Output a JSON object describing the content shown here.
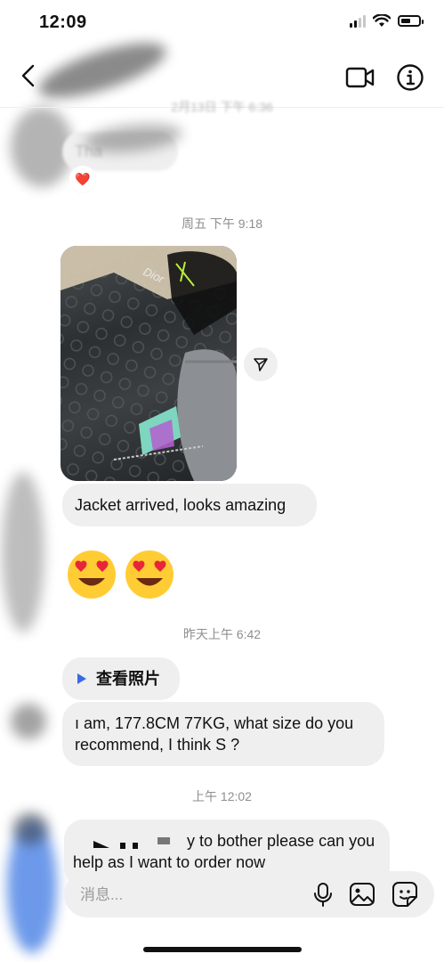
{
  "status_bar": {
    "time": "12:09"
  },
  "header": {
    "back_icon": "chevron-left-icon",
    "video_icon": "video-camera-icon",
    "info_icon": "info-icon"
  },
  "messages": {
    "faded_timestamp": "2月13日 下午 6:36",
    "faded_text": "Tha",
    "faded_reaction": "❤️",
    "ts_friday": "周五 下午 9:18",
    "jacket_text": "Jacket arrived, looks amazing",
    "emoji_pair": [
      "😍",
      "😍"
    ],
    "ts_yesterday": "昨天上午 6:42",
    "view_photo_label": "查看照片",
    "size_question_line1": "ı am, 177.8CM 77KG, what size do you",
    "size_question_line2": "recommend, I think S ?",
    "ts_noon": "上午 12:02",
    "order_line1": "y to bother please can you",
    "order_line2": "help as I want to order now"
  },
  "composer": {
    "placeholder": "消息...",
    "mic_icon": "microphone-icon",
    "gallery_icon": "image-icon",
    "sticker_icon": "sticker-icon"
  },
  "colors": {
    "bubble": "#efefef",
    "timestamp": "#8e8e8e",
    "link_arrow": "#3a6ae0"
  }
}
